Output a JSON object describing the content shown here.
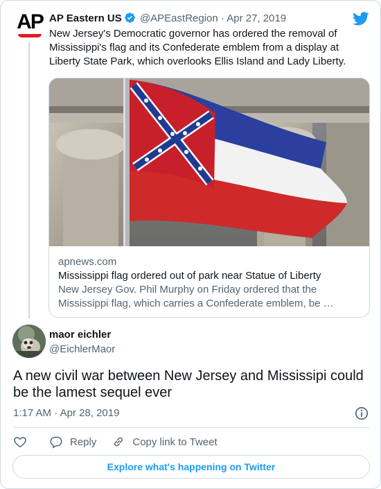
{
  "parent_tweet": {
    "logo_text": "AP",
    "author_name": "AP Eastern US",
    "handle": "@APEastRegion",
    "separator": "·",
    "date": "Apr 27, 2019",
    "text": "New Jersey's Democratic governor has ordered the removal of Mississippi's flag and its Confederate emblem from a display at Liberty State Park, which overlooks Ellis Island and Lady Liberty.",
    "link_card": {
      "image_icon": "mississippi-flag-photo",
      "domain": "apnews.com",
      "title": "Mississippi flag ordered out of park near Statue of Liberty",
      "description_line1": "New Jersey Gov. Phil Murphy on Friday ordered that the",
      "description_line2": "Mississippi flag, which carries a Confederate emblem, be …"
    }
  },
  "main_tweet": {
    "author_name": "maor eichler",
    "handle": "@EichlerMaor",
    "text": "A new civil war between New Jersey and Mississipi could be the lamest sequel ever",
    "time": "1:17 AM",
    "separator": "·",
    "date": "Apr 28, 2019"
  },
  "actions": {
    "like_icon": "heart-icon",
    "reply_label": "Reply",
    "copy_label": "Copy link to Tweet"
  },
  "explore_label": "Explore what's happening on Twitter",
  "colors": {
    "accent": "#1d9bf0",
    "border": "#cfd9de",
    "muted_text": "#536471",
    "ap_red": "#e31b23"
  }
}
